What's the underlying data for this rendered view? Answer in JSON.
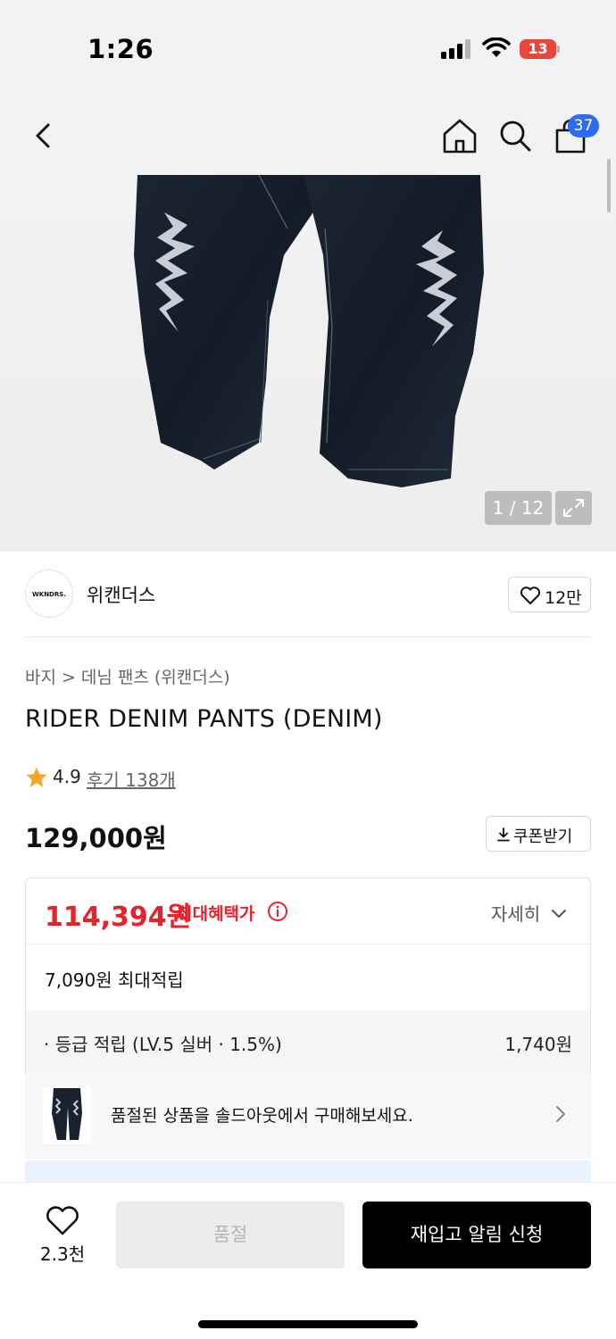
{
  "status_bar": {
    "time": "1:26",
    "battery": "13"
  },
  "header": {
    "cart_count": "37"
  },
  "gallery": {
    "page_indicator": "1 / 12"
  },
  "brand": {
    "logo_text": "WKNDRS.",
    "name": "위캔더스",
    "likes": "12만"
  },
  "breadcrumb": {
    "category": "바지",
    "separator": ">",
    "subcategory": "데님 팬츠 (위캔더스)"
  },
  "product": {
    "title": "RIDER DENIM PANTS (DENIM)",
    "rating": "4.9",
    "reviews": "후기 138개",
    "price": "129,000원",
    "coupon_label": "쿠폰받기"
  },
  "benefits": {
    "max_price": "114,394원",
    "max_label": "최대혜택가",
    "detail_label": "자세히",
    "max_points": "7,090원 최대적립",
    "grade_label": "· 등급 적립 (LV.5 실버 · 1.5%)",
    "grade_value": "1,740원"
  },
  "soldout_banner": {
    "text": "품절된 상품을 솔드아웃에서 구매해보세요."
  },
  "bottom_bar": {
    "wish_count": "2.3천",
    "soldout_label": "품절",
    "restock_label": "재입고 알림 신청"
  },
  "colors": {
    "accent_red": "#e8212b",
    "badge_blue": "#2d6bf0",
    "primary_button": "#000000",
    "star": "#f5a623"
  }
}
